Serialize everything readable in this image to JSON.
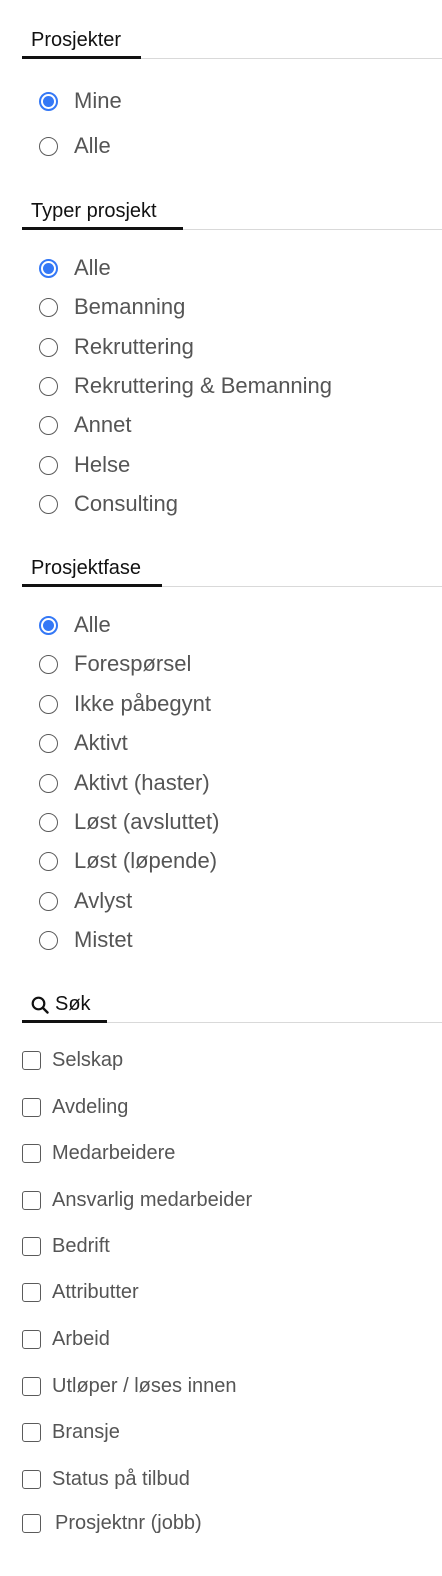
{
  "projects": {
    "title": "Prosjekter",
    "options": [
      {
        "label": "Mine",
        "checked": true
      },
      {
        "label": "Alle",
        "checked": false
      }
    ]
  },
  "project_types": {
    "title": "Typer prosjekt",
    "options": [
      {
        "label": "Alle",
        "checked": true
      },
      {
        "label": "Bemanning",
        "checked": false
      },
      {
        "label": "Rekruttering",
        "checked": false
      },
      {
        "label": "Rekruttering & Bemanning",
        "checked": false
      },
      {
        "label": "Annet",
        "checked": false
      },
      {
        "label": "Helse",
        "checked": false
      },
      {
        "label": "Consulting",
        "checked": false
      }
    ]
  },
  "project_phase": {
    "title": "Prosjektfase",
    "options": [
      {
        "label": "Alle",
        "checked": true
      },
      {
        "label": "Forespørsel",
        "checked": false
      },
      {
        "label": "Ikke påbegynt",
        "checked": false
      },
      {
        "label": "Aktivt",
        "checked": false
      },
      {
        "label": "Aktivt (haster)",
        "checked": false
      },
      {
        "label": "Løst (avsluttet)",
        "checked": false
      },
      {
        "label": "Løst (løpende)",
        "checked": false
      },
      {
        "label": "Avlyst",
        "checked": false
      },
      {
        "label": "Mistet",
        "checked": false
      }
    ]
  },
  "search": {
    "title": "Søk",
    "icon": "search-icon",
    "filters": [
      {
        "label": "Selskap",
        "checked": false
      },
      {
        "label": "Avdeling",
        "checked": false
      },
      {
        "label": "Medarbeidere",
        "checked": false
      },
      {
        "label": "Ansvarlig medarbeider",
        "checked": false
      },
      {
        "label": "Bedrift",
        "checked": false
      },
      {
        "label": "Attributter",
        "checked": false
      },
      {
        "label": "Arbeid",
        "checked": false
      },
      {
        "label": "Utløper / løses innen",
        "checked": false
      },
      {
        "label": "Bransje",
        "checked": false
      },
      {
        "label": "Status på tilbud",
        "checked": false
      },
      {
        "label": "Prosjektnr (jobb)",
        "checked": false
      }
    ]
  },
  "colors": {
    "accent": "#3478f6",
    "text": "#555555",
    "heading": "#111111",
    "divider": "#d9d9d9"
  }
}
